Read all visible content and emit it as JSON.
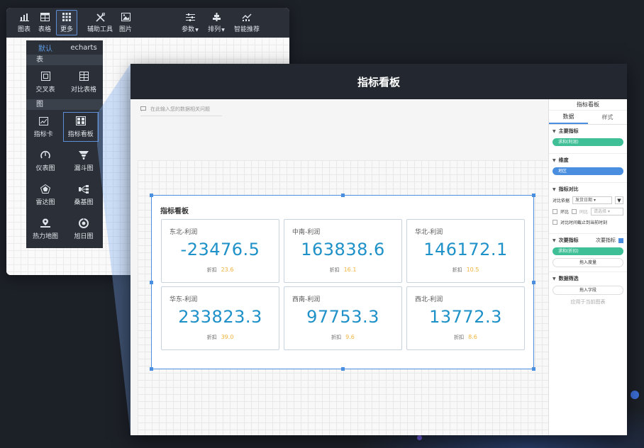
{
  "toolbar": {
    "items": [
      {
        "label": "图表",
        "icon": "bar-chart-icon"
      },
      {
        "label": "表格",
        "icon": "table-icon"
      },
      {
        "label": "更多",
        "icon": "grid-dots-icon"
      },
      {
        "label": "辅助工具",
        "icon": "tools-icon"
      },
      {
        "label": "图片",
        "icon": "image-icon"
      },
      {
        "label": "参数",
        "icon": "sliders-icon"
      },
      {
        "label": "排列",
        "icon": "align-icon"
      },
      {
        "label": "智能推荐",
        "icon": "trend-chart-icon"
      }
    ]
  },
  "dropdown": {
    "tabs": [
      "默认",
      "echarts"
    ],
    "sections": [
      {
        "title": "表",
        "items": [
          {
            "label": "交叉表"
          },
          {
            "label": "对比表格"
          }
        ]
      },
      {
        "title": "图",
        "items": [
          {
            "label": "指标卡"
          },
          {
            "label": "指标看板"
          },
          {
            "label": "仪表图"
          },
          {
            "label": "漏斗图"
          },
          {
            "label": "雷达图"
          },
          {
            "label": "桑基图"
          },
          {
            "label": "热力地图"
          },
          {
            "label": "旭日图"
          }
        ]
      }
    ]
  },
  "front": {
    "title": "指标看板",
    "search_placeholder": "在此输入您的数据相关问题",
    "widget_title": "指标看板",
    "cards": [
      {
        "label": "东北-利润",
        "value": "-23476.5",
        "foot_label": "折扣",
        "rate": "23.6"
      },
      {
        "label": "中南-利润",
        "value": "163838.6",
        "foot_label": "折扣",
        "rate": "16.1"
      },
      {
        "label": "华北-利润",
        "value": "146172.1",
        "foot_label": "折扣",
        "rate": "10.5"
      },
      {
        "label": "华东-利润",
        "value": "233823.3",
        "foot_label": "折扣",
        "rate": "39.0"
      },
      {
        "label": "西南-利润",
        "value": "97753.3",
        "foot_label": "折扣",
        "rate": "9.6"
      },
      {
        "label": "西北-利润",
        "value": "13772.3",
        "foot_label": "折扣",
        "rate": "8.6"
      }
    ]
  },
  "panel": {
    "title": "指标看板",
    "tabs": [
      "数据",
      "样式"
    ],
    "main_metric": {
      "title": "主要指标",
      "pill": "求和(利润)"
    },
    "dimension": {
      "title": "维度",
      "pill": "地区"
    },
    "compare": {
      "title": "指标对比",
      "basis_label": "对比依据",
      "basis_value": "发货日期",
      "ring_label": "环比",
      "yoy_label": "同比",
      "select_placeholder": "请选择",
      "cutoff_label": "对比时间截止到当前时刻"
    },
    "secondary": {
      "title": "次要指标",
      "toggle_label": "次要指标",
      "pill": "求和(折扣)",
      "add_button": "拖入度量"
    },
    "filter": {
      "title": "数据筛选",
      "add_button": "拖入字段",
      "hint": "应用于当前图表"
    }
  }
}
